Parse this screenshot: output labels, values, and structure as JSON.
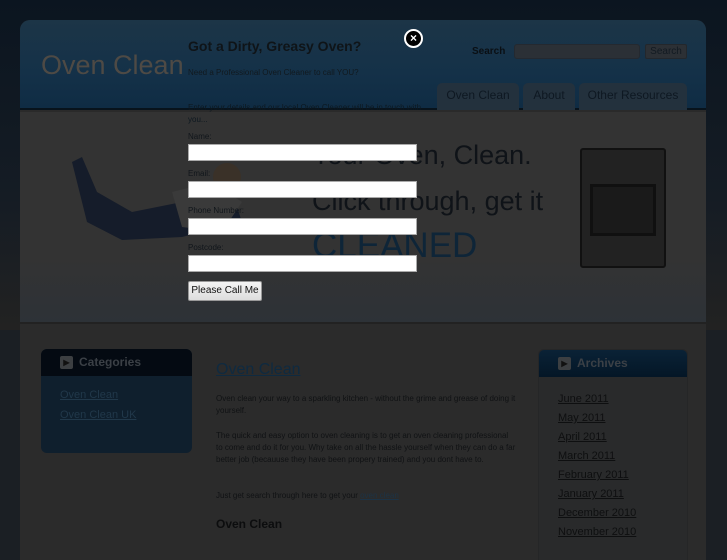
{
  "site": {
    "logo": "Oven Clean",
    "search_label": "Search",
    "search_button": "Search",
    "search_value": ""
  },
  "nav": [
    {
      "label": "Oven Clean"
    },
    {
      "label": "About"
    },
    {
      "label": "Other Resources"
    }
  ],
  "banner": {
    "line1": "Your Oven, Clean.",
    "line2": "Click through, get it",
    "line3": "CLEANED"
  },
  "categories": {
    "title": "Categories",
    "items": [
      "Oven Clean",
      "Oven Clean UK"
    ]
  },
  "archives": {
    "title": "Archives",
    "items": [
      "June 2011",
      "May 2011",
      "April 2011",
      "March 2011",
      "February 2011",
      "January 2011",
      "December 2010",
      "November 2010"
    ]
  },
  "post": {
    "title": "Oven Clean",
    "p1": "Oven clean your way to a sparkling kitchen - without the grime and grease of doing it yourself.",
    "p2": "The quick and easy option to oven cleaning is to get an oven cleaning professional to come and do it for you. Why take on all the hassle yourself when they can do a far better job (becauuse they have been propery trained) and you dont have to.",
    "p3_prefix": "Just get search through here to get your ",
    "p3_link": "oven clean",
    "subheading": "Oven Clean"
  },
  "modal": {
    "title": "Got a Dirty, Greasy Oven?",
    "subtitle": "Need a Professional Oven Cleaner to call YOU?",
    "intro": "Enter your details and our local Oven Cleaner will be in touch with you...",
    "fields": [
      {
        "label": "Name:",
        "value": ""
      },
      {
        "label": "Email:",
        "value": ""
      },
      {
        "label": "Phone Number:",
        "value": ""
      },
      {
        "label": "Postcode:",
        "value": ""
      }
    ],
    "submit": "Please Call Me",
    "close_icon": "close-icon"
  }
}
